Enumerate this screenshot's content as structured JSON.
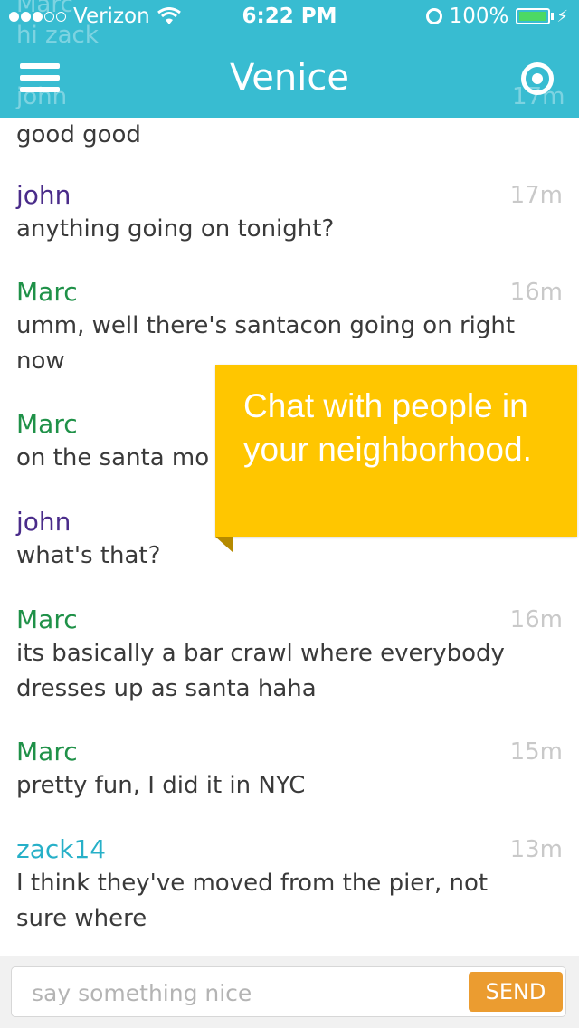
{
  "status_bar": {
    "carrier": "Verizon",
    "time": "6:22 PM",
    "battery": "100%",
    "signal_bars_filled": 3,
    "signal_bars_total": 5
  },
  "nav": {
    "title": "Venice",
    "menu_icon": "hamburger-menu-icon",
    "location_icon": "location-target-icon",
    "color": "#29b7ce"
  },
  "ghost_messages": {
    "author_1": "Marc",
    "text_1": "hi zack",
    "author_2": "john",
    "time_2": "17m"
  },
  "messages": [
    {
      "author": "",
      "time": "",
      "text": "good good",
      "color": "#4a2c8a"
    },
    {
      "author": "john",
      "time": "17m",
      "text": "anything going on tonight?",
      "color": "#4a2c8a"
    },
    {
      "author": "Marc",
      "time": "16m",
      "text": "umm, well there's santacon going on right now",
      "color": "#1f9148"
    },
    {
      "author": "Marc",
      "time": "",
      "text": "on the santa mo",
      "color": "#1f9148"
    },
    {
      "author": "john",
      "time": "",
      "text": "what's that?",
      "color": "#4a2c8a"
    },
    {
      "author": "Marc",
      "time": "16m",
      "text": "its basically a bar crawl where everybody dresses up as santa haha",
      "color": "#1f9148"
    },
    {
      "author": "Marc",
      "time": "15m",
      "text": "pretty fun, I did it in NYC",
      "color": "#1f9148"
    },
    {
      "author": "zack14",
      "time": "13m",
      "text": "I think they've moved from the pier, not sure where",
      "color": "#27b0c8"
    }
  ],
  "tooltip": {
    "text": "Chat with people in your neighborhood.",
    "color": "#ffc600"
  },
  "composer": {
    "placeholder": "say something nice",
    "value": "",
    "send_label": "SEND",
    "send_color": "#eb9c30"
  }
}
